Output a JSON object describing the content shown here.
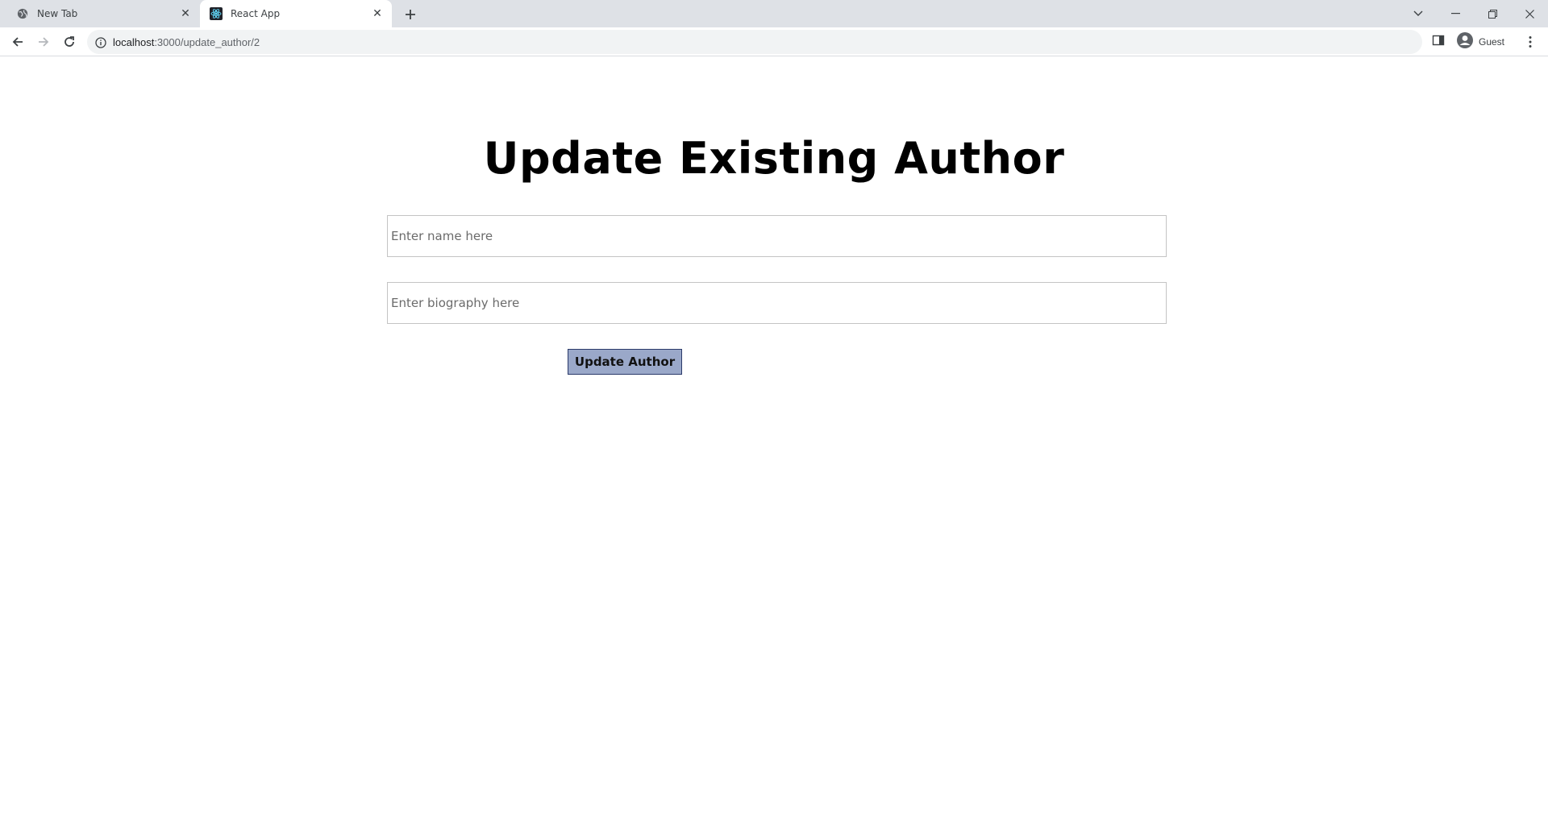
{
  "browser": {
    "tabs": [
      {
        "title": "New Tab",
        "icon": "globe-icon",
        "active": false
      },
      {
        "title": "React App",
        "icon": "react-icon",
        "active": true
      }
    ],
    "url_host": "localhost",
    "url_path": ":3000/update_author/2",
    "profile_label": "Guest"
  },
  "page": {
    "heading": "Update Existing Author",
    "name_placeholder": "Enter name here",
    "name_value": "",
    "bio_placeholder": "Enter biography here",
    "bio_value": "",
    "submit_label": "Update Author",
    "submit_color": "#9aa8c9"
  }
}
